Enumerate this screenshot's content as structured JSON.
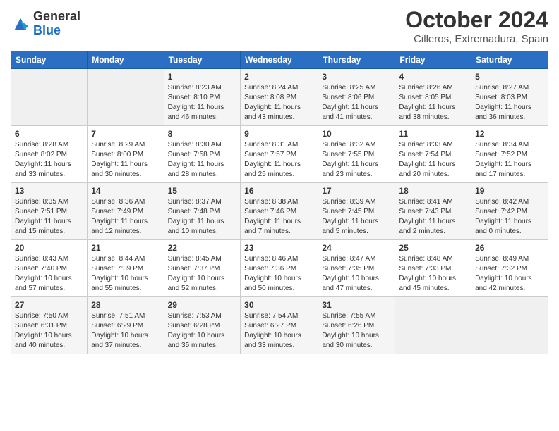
{
  "logo": {
    "general": "General",
    "blue": "Blue"
  },
  "title": {
    "month": "October 2024",
    "location": "Cilleros, Extremadura, Spain"
  },
  "headers": [
    "Sunday",
    "Monday",
    "Tuesday",
    "Wednesday",
    "Thursday",
    "Friday",
    "Saturday"
  ],
  "weeks": [
    [
      {
        "day": "",
        "sunrise": "",
        "sunset": "",
        "daylight": ""
      },
      {
        "day": "",
        "sunrise": "",
        "sunset": "",
        "daylight": ""
      },
      {
        "day": "1",
        "sunrise": "Sunrise: 8:23 AM",
        "sunset": "Sunset: 8:10 PM",
        "daylight": "Daylight: 11 hours and 46 minutes."
      },
      {
        "day": "2",
        "sunrise": "Sunrise: 8:24 AM",
        "sunset": "Sunset: 8:08 PM",
        "daylight": "Daylight: 11 hours and 43 minutes."
      },
      {
        "day": "3",
        "sunrise": "Sunrise: 8:25 AM",
        "sunset": "Sunset: 8:06 PM",
        "daylight": "Daylight: 11 hours and 41 minutes."
      },
      {
        "day": "4",
        "sunrise": "Sunrise: 8:26 AM",
        "sunset": "Sunset: 8:05 PM",
        "daylight": "Daylight: 11 hours and 38 minutes."
      },
      {
        "day": "5",
        "sunrise": "Sunrise: 8:27 AM",
        "sunset": "Sunset: 8:03 PM",
        "daylight": "Daylight: 11 hours and 36 minutes."
      }
    ],
    [
      {
        "day": "6",
        "sunrise": "Sunrise: 8:28 AM",
        "sunset": "Sunset: 8:02 PM",
        "daylight": "Daylight: 11 hours and 33 minutes."
      },
      {
        "day": "7",
        "sunrise": "Sunrise: 8:29 AM",
        "sunset": "Sunset: 8:00 PM",
        "daylight": "Daylight: 11 hours and 30 minutes."
      },
      {
        "day": "8",
        "sunrise": "Sunrise: 8:30 AM",
        "sunset": "Sunset: 7:58 PM",
        "daylight": "Daylight: 11 hours and 28 minutes."
      },
      {
        "day": "9",
        "sunrise": "Sunrise: 8:31 AM",
        "sunset": "Sunset: 7:57 PM",
        "daylight": "Daylight: 11 hours and 25 minutes."
      },
      {
        "day": "10",
        "sunrise": "Sunrise: 8:32 AM",
        "sunset": "Sunset: 7:55 PM",
        "daylight": "Daylight: 11 hours and 23 minutes."
      },
      {
        "day": "11",
        "sunrise": "Sunrise: 8:33 AM",
        "sunset": "Sunset: 7:54 PM",
        "daylight": "Daylight: 11 hours and 20 minutes."
      },
      {
        "day": "12",
        "sunrise": "Sunrise: 8:34 AM",
        "sunset": "Sunset: 7:52 PM",
        "daylight": "Daylight: 11 hours and 17 minutes."
      }
    ],
    [
      {
        "day": "13",
        "sunrise": "Sunrise: 8:35 AM",
        "sunset": "Sunset: 7:51 PM",
        "daylight": "Daylight: 11 hours and 15 minutes."
      },
      {
        "day": "14",
        "sunrise": "Sunrise: 8:36 AM",
        "sunset": "Sunset: 7:49 PM",
        "daylight": "Daylight: 11 hours and 12 minutes."
      },
      {
        "day": "15",
        "sunrise": "Sunrise: 8:37 AM",
        "sunset": "Sunset: 7:48 PM",
        "daylight": "Daylight: 11 hours and 10 minutes."
      },
      {
        "day": "16",
        "sunrise": "Sunrise: 8:38 AM",
        "sunset": "Sunset: 7:46 PM",
        "daylight": "Daylight: 11 hours and 7 minutes."
      },
      {
        "day": "17",
        "sunrise": "Sunrise: 8:39 AM",
        "sunset": "Sunset: 7:45 PM",
        "daylight": "Daylight: 11 hours and 5 minutes."
      },
      {
        "day": "18",
        "sunrise": "Sunrise: 8:41 AM",
        "sunset": "Sunset: 7:43 PM",
        "daylight": "Daylight: 11 hours and 2 minutes."
      },
      {
        "day": "19",
        "sunrise": "Sunrise: 8:42 AM",
        "sunset": "Sunset: 7:42 PM",
        "daylight": "Daylight: 11 hours and 0 minutes."
      }
    ],
    [
      {
        "day": "20",
        "sunrise": "Sunrise: 8:43 AM",
        "sunset": "Sunset: 7:40 PM",
        "daylight": "Daylight: 10 hours and 57 minutes."
      },
      {
        "day": "21",
        "sunrise": "Sunrise: 8:44 AM",
        "sunset": "Sunset: 7:39 PM",
        "daylight": "Daylight: 10 hours and 55 minutes."
      },
      {
        "day": "22",
        "sunrise": "Sunrise: 8:45 AM",
        "sunset": "Sunset: 7:37 PM",
        "daylight": "Daylight: 10 hours and 52 minutes."
      },
      {
        "day": "23",
        "sunrise": "Sunrise: 8:46 AM",
        "sunset": "Sunset: 7:36 PM",
        "daylight": "Daylight: 10 hours and 50 minutes."
      },
      {
        "day": "24",
        "sunrise": "Sunrise: 8:47 AM",
        "sunset": "Sunset: 7:35 PM",
        "daylight": "Daylight: 10 hours and 47 minutes."
      },
      {
        "day": "25",
        "sunrise": "Sunrise: 8:48 AM",
        "sunset": "Sunset: 7:33 PM",
        "daylight": "Daylight: 10 hours and 45 minutes."
      },
      {
        "day": "26",
        "sunrise": "Sunrise: 8:49 AM",
        "sunset": "Sunset: 7:32 PM",
        "daylight": "Daylight: 10 hours and 42 minutes."
      }
    ],
    [
      {
        "day": "27",
        "sunrise": "Sunrise: 7:50 AM",
        "sunset": "Sunset: 6:31 PM",
        "daylight": "Daylight: 10 hours and 40 minutes."
      },
      {
        "day": "28",
        "sunrise": "Sunrise: 7:51 AM",
        "sunset": "Sunset: 6:29 PM",
        "daylight": "Daylight: 10 hours and 37 minutes."
      },
      {
        "day": "29",
        "sunrise": "Sunrise: 7:53 AM",
        "sunset": "Sunset: 6:28 PM",
        "daylight": "Daylight: 10 hours and 35 minutes."
      },
      {
        "day": "30",
        "sunrise": "Sunrise: 7:54 AM",
        "sunset": "Sunset: 6:27 PM",
        "daylight": "Daylight: 10 hours and 33 minutes."
      },
      {
        "day": "31",
        "sunrise": "Sunrise: 7:55 AM",
        "sunset": "Sunset: 6:26 PM",
        "daylight": "Daylight: 10 hours and 30 minutes."
      },
      {
        "day": "",
        "sunrise": "",
        "sunset": "",
        "daylight": ""
      },
      {
        "day": "",
        "sunrise": "",
        "sunset": "",
        "daylight": ""
      }
    ]
  ]
}
